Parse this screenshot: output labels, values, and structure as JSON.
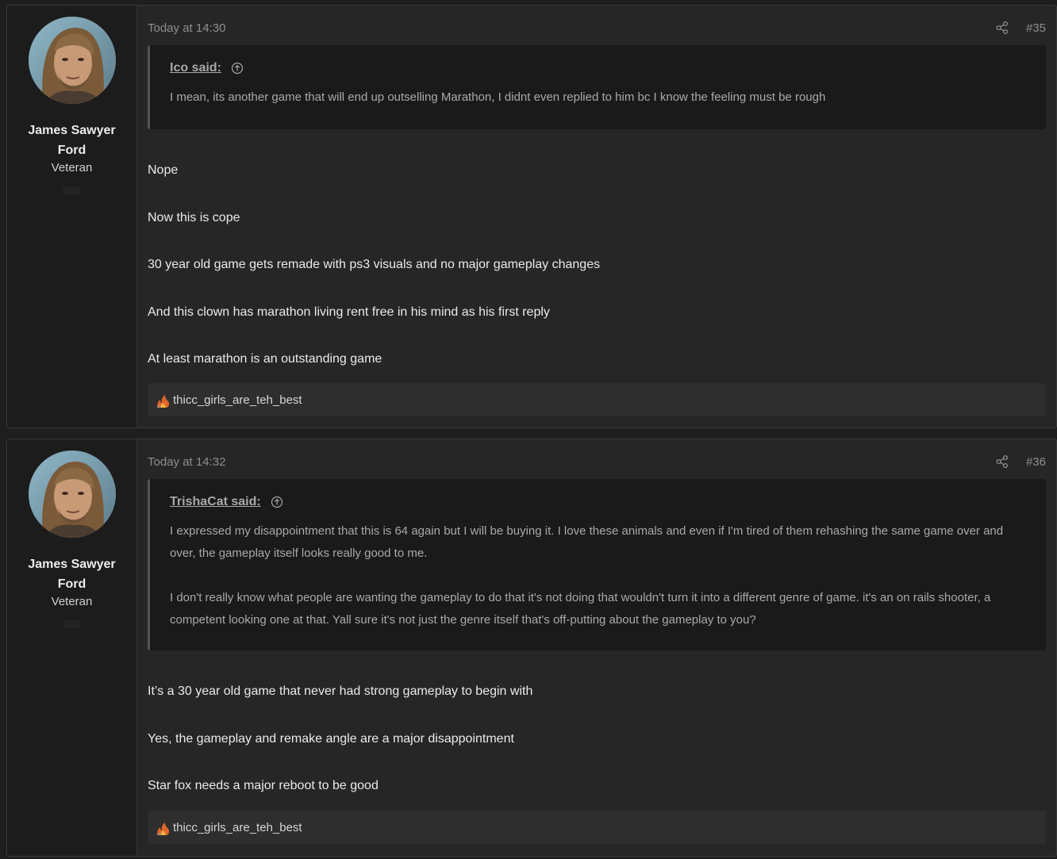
{
  "posts": [
    {
      "author": {
        "name": "James Sawyer Ford",
        "title": "Veteran"
      },
      "date": "Today at 14:30",
      "number": "#35",
      "quote": {
        "author": "Ico said:",
        "paragraphs": [
          "I mean, its another game that will end up outselling Marathon, I didnt even replied to him bc I know the feeling must be rough"
        ]
      },
      "message": [
        "Nope",
        "Now this is cope",
        "30 year old game gets remade with ps3 visuals and no major gameplay changes",
        "And this clown has marathon living rent free in his mind as his first reply",
        "At least marathon is an outstanding game"
      ],
      "reaction_user": "thicc_girls_are_teh_best"
    },
    {
      "author": {
        "name": "James Sawyer Ford",
        "title": "Veteran"
      },
      "date": "Today at 14:32",
      "number": "#36",
      "quote": {
        "author": "TrishaCat said:",
        "paragraphs": [
          "I expressed my disappointment that this is 64 again but I will be buying it. I love these animals and even if I'm tired of them rehashing the same game over and over, the gameplay itself looks really good to me.",
          "I don't really know what people are wanting the gameplay to do that it's not doing that wouldn't turn it into a different genre of game. it's an on rails shooter, a competent looking one at that. Yall sure it's not just the genre itself that's off-putting about the gameplay to you?"
        ]
      },
      "message": [
        "It’s a 30 year old game that never had strong gameplay to begin with",
        "Yes, the gameplay and remake angle are a major disappointment",
        "Star fox needs a major reboot to be good"
      ],
      "reaction_user": "thicc_girls_are_teh_best"
    }
  ],
  "icons": {
    "share": "share-icon",
    "quote_jump": "arrow-up-circle-icon",
    "reaction": "fire-reaction-icon"
  }
}
